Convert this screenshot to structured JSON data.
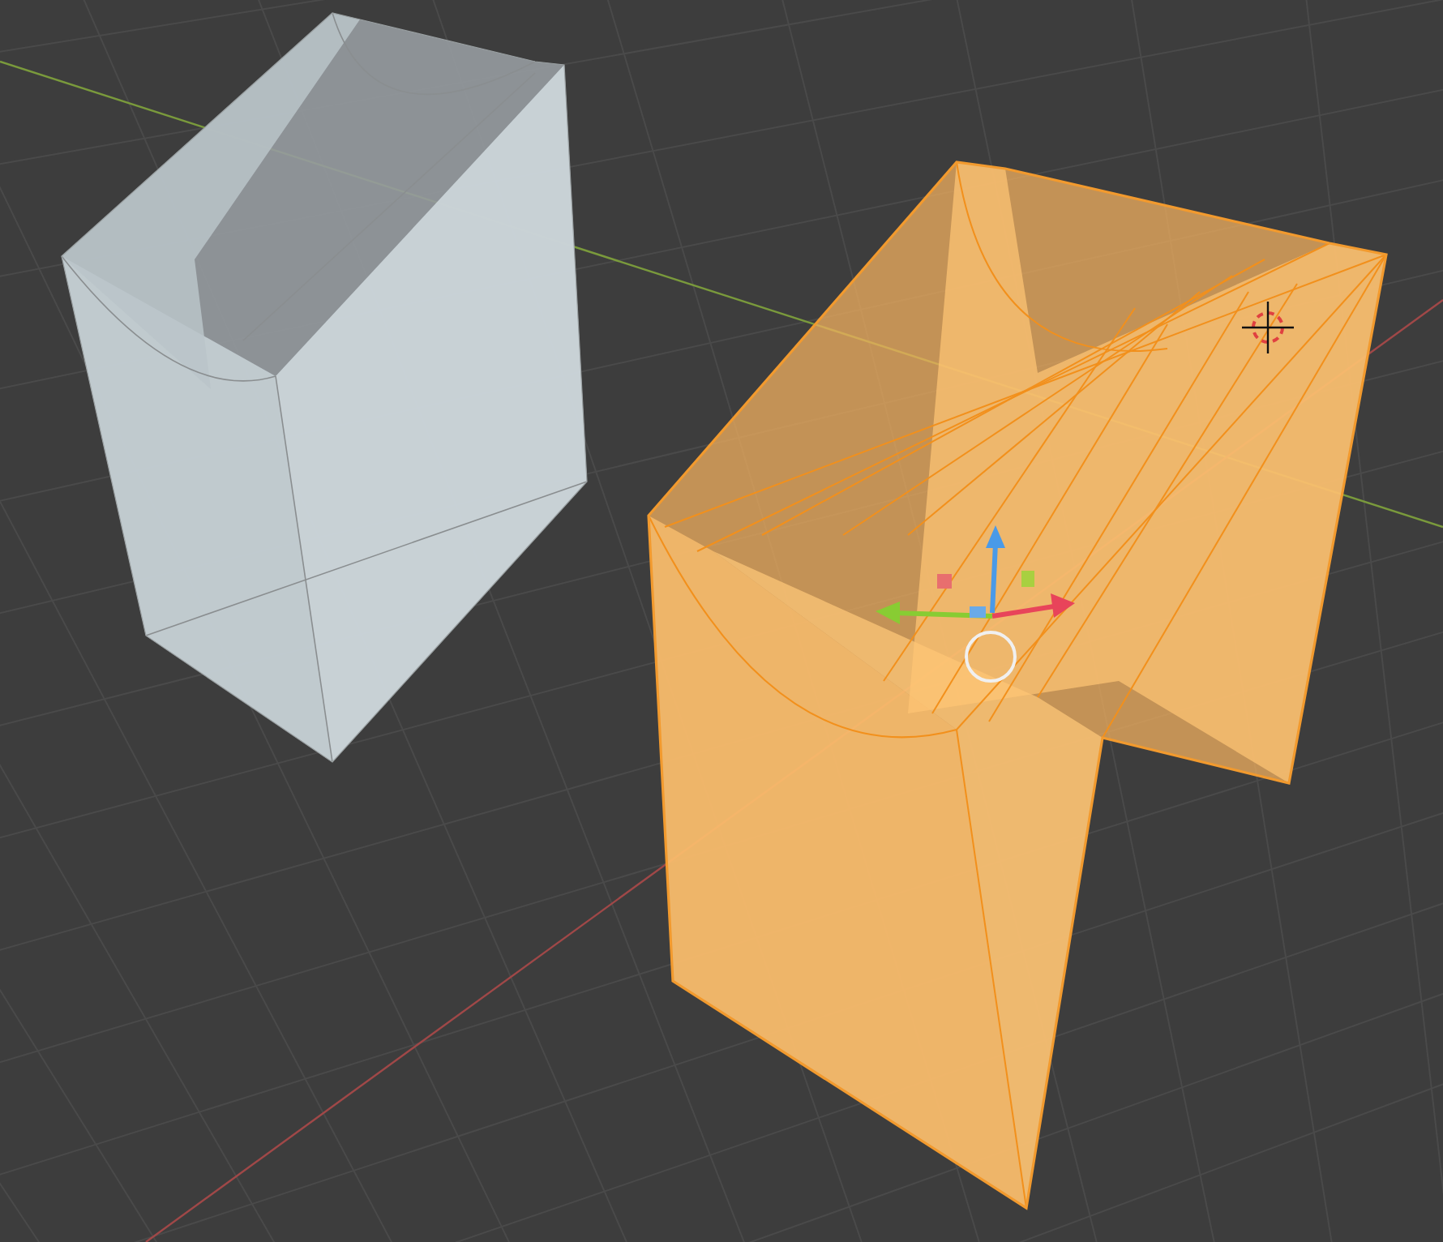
{
  "viewport": {
    "objects": [
      {
        "selected": false
      },
      {
        "selected": true
      }
    ]
  }
}
